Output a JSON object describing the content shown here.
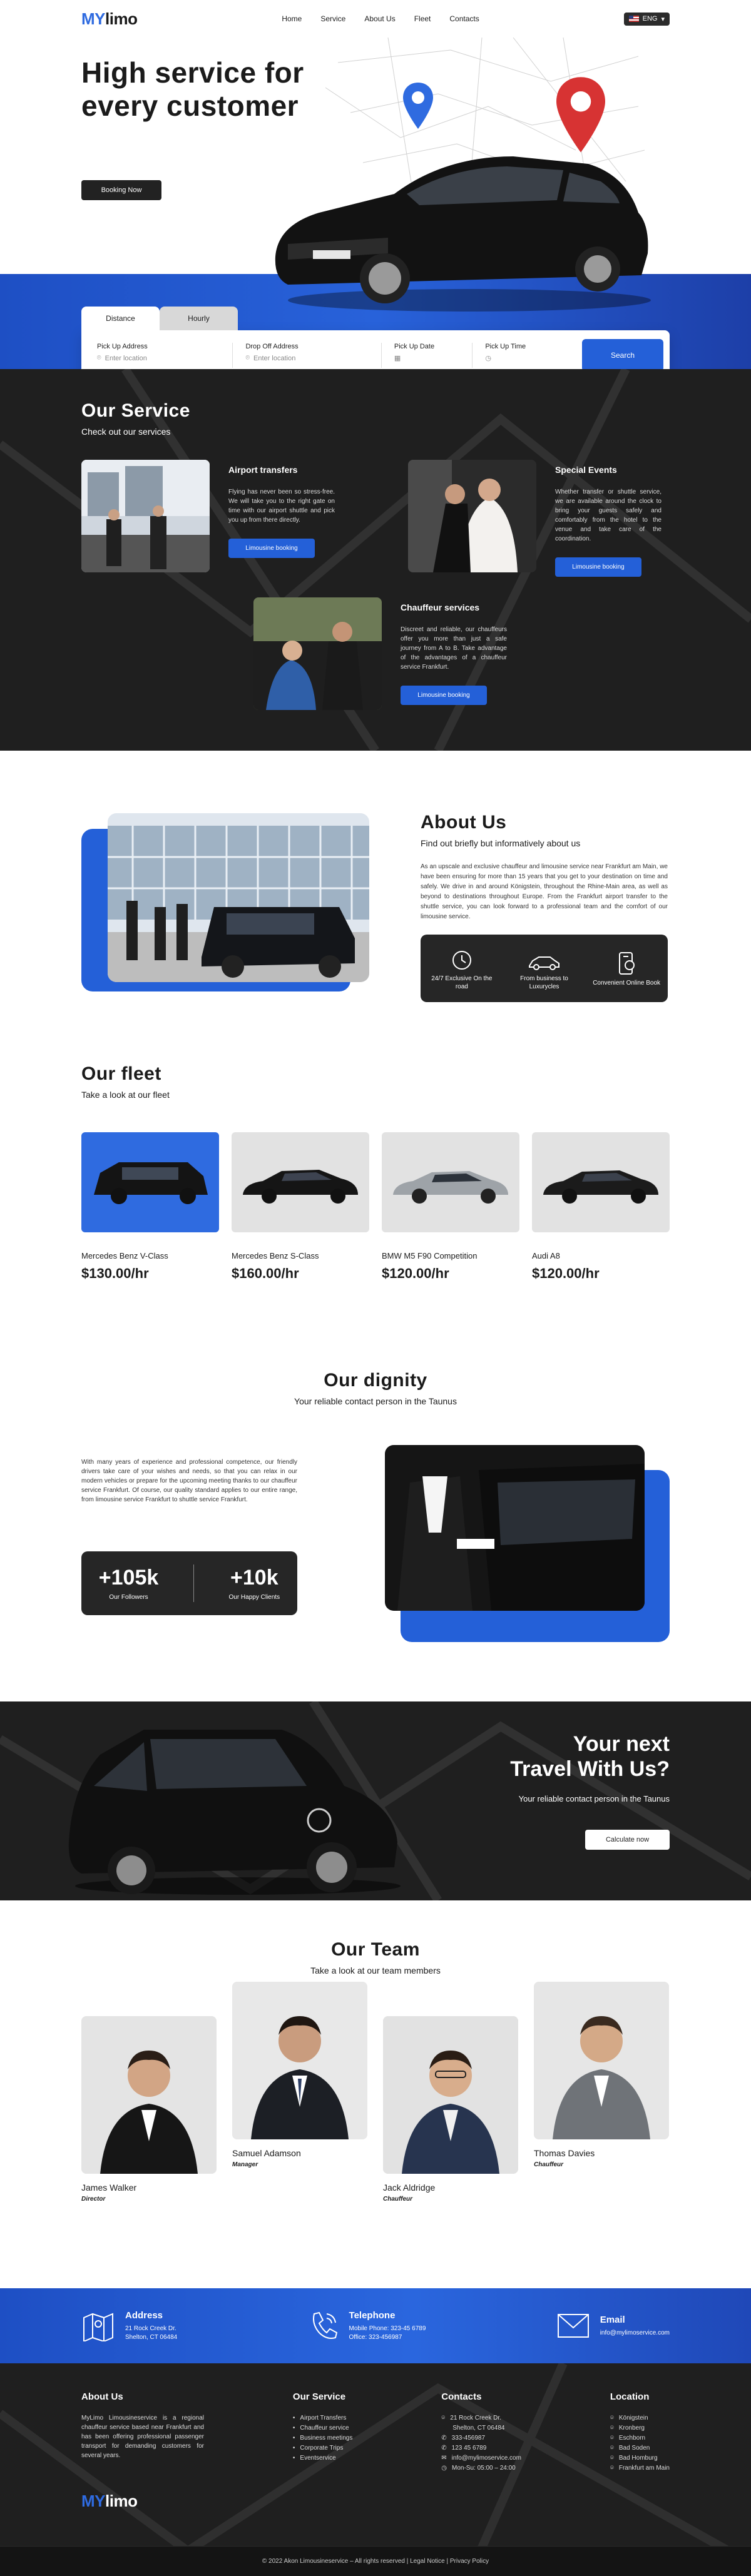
{
  "brand": {
    "my": "MY",
    "limo": "limo"
  },
  "nav": {
    "items": [
      "Home",
      "Service",
      "About Us",
      "Fleet",
      "Contacts"
    ],
    "lang": "ENG"
  },
  "hero": {
    "title": "High service for every customer",
    "button": "Booking Now"
  },
  "booking": {
    "tabs": [
      "Distance",
      "Hourly"
    ],
    "fields": [
      {
        "label": "Pick Up Address",
        "placeholder": "Enter location",
        "icon": "pin-icon"
      },
      {
        "label": "Drop Off Address",
        "placeholder": "Enter location",
        "icon": "pin-icon"
      },
      {
        "label": "Pick Up Date",
        "placeholder": "",
        "icon": "calendar-icon"
      },
      {
        "label": "Pick Up Time",
        "placeholder": "",
        "icon": "clock-icon"
      }
    ],
    "search": "Search"
  },
  "service": {
    "title": "Our Service",
    "subtitle": "Check out our services",
    "items": [
      {
        "title": "Airport transfers",
        "text": "Flying has never been so stress-free. We will take you to the right gate on time with our airport shuttle and pick you up from there directly.",
        "button": "Limousine booking"
      },
      {
        "title": "Special Events",
        "text": "Whether transfer or shuttle service, we are available around the clock to bring your guests safely and comfortably from the hotel to the venue and take care of the coordination.",
        "button": "Limousine booking"
      },
      {
        "title": "Chauffeur services",
        "text": "Discreet and reliable, our chauffeurs offer you more than just a safe journey from A to B. Take advantage of the advantages of a chauffeur service Frankfurt.",
        "button": "Limousine booking"
      }
    ]
  },
  "about": {
    "title": "About Us",
    "subtitle": "Find out briefly but informatively about us",
    "text": "As an upscale and exclusive chauffeur and limousine service near Frankfurt am Main, we have been ensuring for more than 15 years that you get to your destination on time and safely. We drive in and around Königstein, throughout the Rhine-Main area, as well as beyond to destinations throughout Europe. From the Frankfurt airport transfer to the shuttle service, you can look forward to a professional team and the comfort of our limousine service.",
    "features": [
      "24/7 Exclusive On the road",
      "From business to Luxurycles",
      "Convenient Online Book"
    ]
  },
  "fleet": {
    "title": "Our fleet",
    "subtitle": "Take a look at our fleet",
    "items": [
      {
        "name": "Mercedes Benz V-Class",
        "price": "$130.00/hr"
      },
      {
        "name": "Mercedes Benz S-Class",
        "price": "$160.00/hr"
      },
      {
        "name": "BMW M5 F90 Competition",
        "price": "$120.00/hr"
      },
      {
        "name": "Audi A8",
        "price": "$120.00/hr"
      }
    ]
  },
  "dignity": {
    "title": "Our dignity",
    "subtitle": "Your reliable contact person in the Taunus",
    "text": "With many years of experience and professional competence, our friendly drivers take care of your wishes and needs, so that you can relax in our modern vehicles or prepare for the upcoming meeting thanks to our chauffeur service Frankfurt. Of course, our quality standard applies to our entire range, from limousine service Frankfurt to shuttle service Frankfurt.",
    "stats": [
      {
        "value": "+105k",
        "label": "Our Followers"
      },
      {
        "value": "+10k",
        "label": "Our Happy Clients"
      }
    ]
  },
  "travel": {
    "title1": "Your next",
    "title2": "Travel With Us?",
    "subtitle": "Your reliable contact person in the Taunus",
    "button": "Calculate now"
  },
  "team": {
    "title": "Our Team",
    "subtitle": "Take a look at our team members",
    "members": [
      {
        "name": "James Walker",
        "role": "Director"
      },
      {
        "name": "Samuel Adamson",
        "role": "Manager"
      },
      {
        "name": "Jack Aldridge",
        "role": "Chauffeur"
      },
      {
        "name": "Thomas Davies",
        "role": "Chauffeur"
      }
    ]
  },
  "contact": {
    "address": {
      "title": "Address",
      "line1": "21 Rock Creek Dr.",
      "line2": "Shelton, CT 06484"
    },
    "phone": {
      "title": "Telephone",
      "line1": "Mobile Phone: 323-45 6789",
      "line2": "Office: 323-456987"
    },
    "email": {
      "title": "Email",
      "line1": "info@mylimoservice.com"
    }
  },
  "footer": {
    "about": {
      "title": "About Us",
      "text": "MyLimo Limousineservice is a regional chauffeur service based near Frankfurt and has been offering professional passenger transport for demanding customers for several years."
    },
    "service": {
      "title": "Our Service",
      "items": [
        "Airport Transfers",
        "Chauffeur service",
        "Business meetings",
        "Corporate Trips",
        "Eventservice"
      ]
    },
    "contacts": {
      "title": "Contacts",
      "items": [
        "21 Rock Creek Dr.",
        "Shelton, CT 06484",
        "333-456987",
        "123 45 6789",
        "info@mylimoservice.com",
        "Mon-Su: 05:00 – 24:00"
      ]
    },
    "location": {
      "title": "Location",
      "items": [
        "Königstein",
        "Kronberg",
        "Eschborn",
        "Bad Soden",
        "Bad Homburg",
        "Frankfurt am Main"
      ]
    },
    "copyright": "© 2022 Akon Limousineservice – All rights reserved | Legal Notice | Privacy Policy"
  },
  "colors": {
    "accent": "#2460d8",
    "dark": "#1f1f1f"
  }
}
